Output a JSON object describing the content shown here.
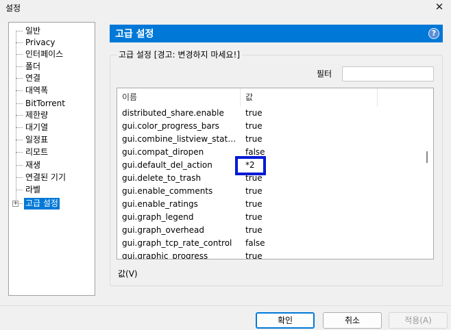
{
  "window": {
    "title": "설정",
    "close_glyph": "✕"
  },
  "tree": {
    "items": [
      {
        "label": "일반"
      },
      {
        "label": "Privacy"
      },
      {
        "label": "인터페이스"
      },
      {
        "label": "폴더"
      },
      {
        "label": "연결"
      },
      {
        "label": "대역폭"
      },
      {
        "label": "BitTorrent"
      },
      {
        "label": "제한량"
      },
      {
        "label": "대기열"
      },
      {
        "label": "일정표"
      },
      {
        "label": "리모트"
      },
      {
        "label": "재생"
      },
      {
        "label": "연결된 기기"
      },
      {
        "label": "라벨"
      },
      {
        "label": "고급 설정"
      }
    ],
    "selected_index": 14,
    "expander_glyph": "+"
  },
  "panel": {
    "header_title": "고급 설정",
    "help_glyph": "?",
    "group_title": "고급 설정 [경고: 변경하지 마세요!]",
    "filter_label": "필터",
    "filter_value": "",
    "columns": {
      "name": "이름",
      "value": "값"
    },
    "rows": [
      {
        "name": "distributed_share.enable",
        "value": "true"
      },
      {
        "name": "gui.color_progress_bars",
        "value": "true"
      },
      {
        "name": "gui.combine_listview_status_d...",
        "value": "true"
      },
      {
        "name": "gui.compat_diropen",
        "value": "false"
      },
      {
        "name": "gui.default_del_action",
        "value": "*2"
      },
      {
        "name": "gui.delete_to_trash",
        "value": "true"
      },
      {
        "name": "gui.enable_comments",
        "value": "true"
      },
      {
        "name": "gui.enable_ratings",
        "value": "true"
      },
      {
        "name": "gui.graph_legend",
        "value": "true"
      },
      {
        "name": "gui.graph_overhead",
        "value": "true"
      },
      {
        "name": "gui.graph_tcp_rate_control",
        "value": "false"
      },
      {
        "name": "gui.graphic_progress",
        "value": "true"
      }
    ],
    "value_label": "값(V)"
  },
  "buttons": {
    "ok": "확인",
    "cancel": "취소",
    "apply": "적용(A)"
  },
  "colors": {
    "accent": "#0078d7",
    "highlight_box": "#0019d6"
  }
}
